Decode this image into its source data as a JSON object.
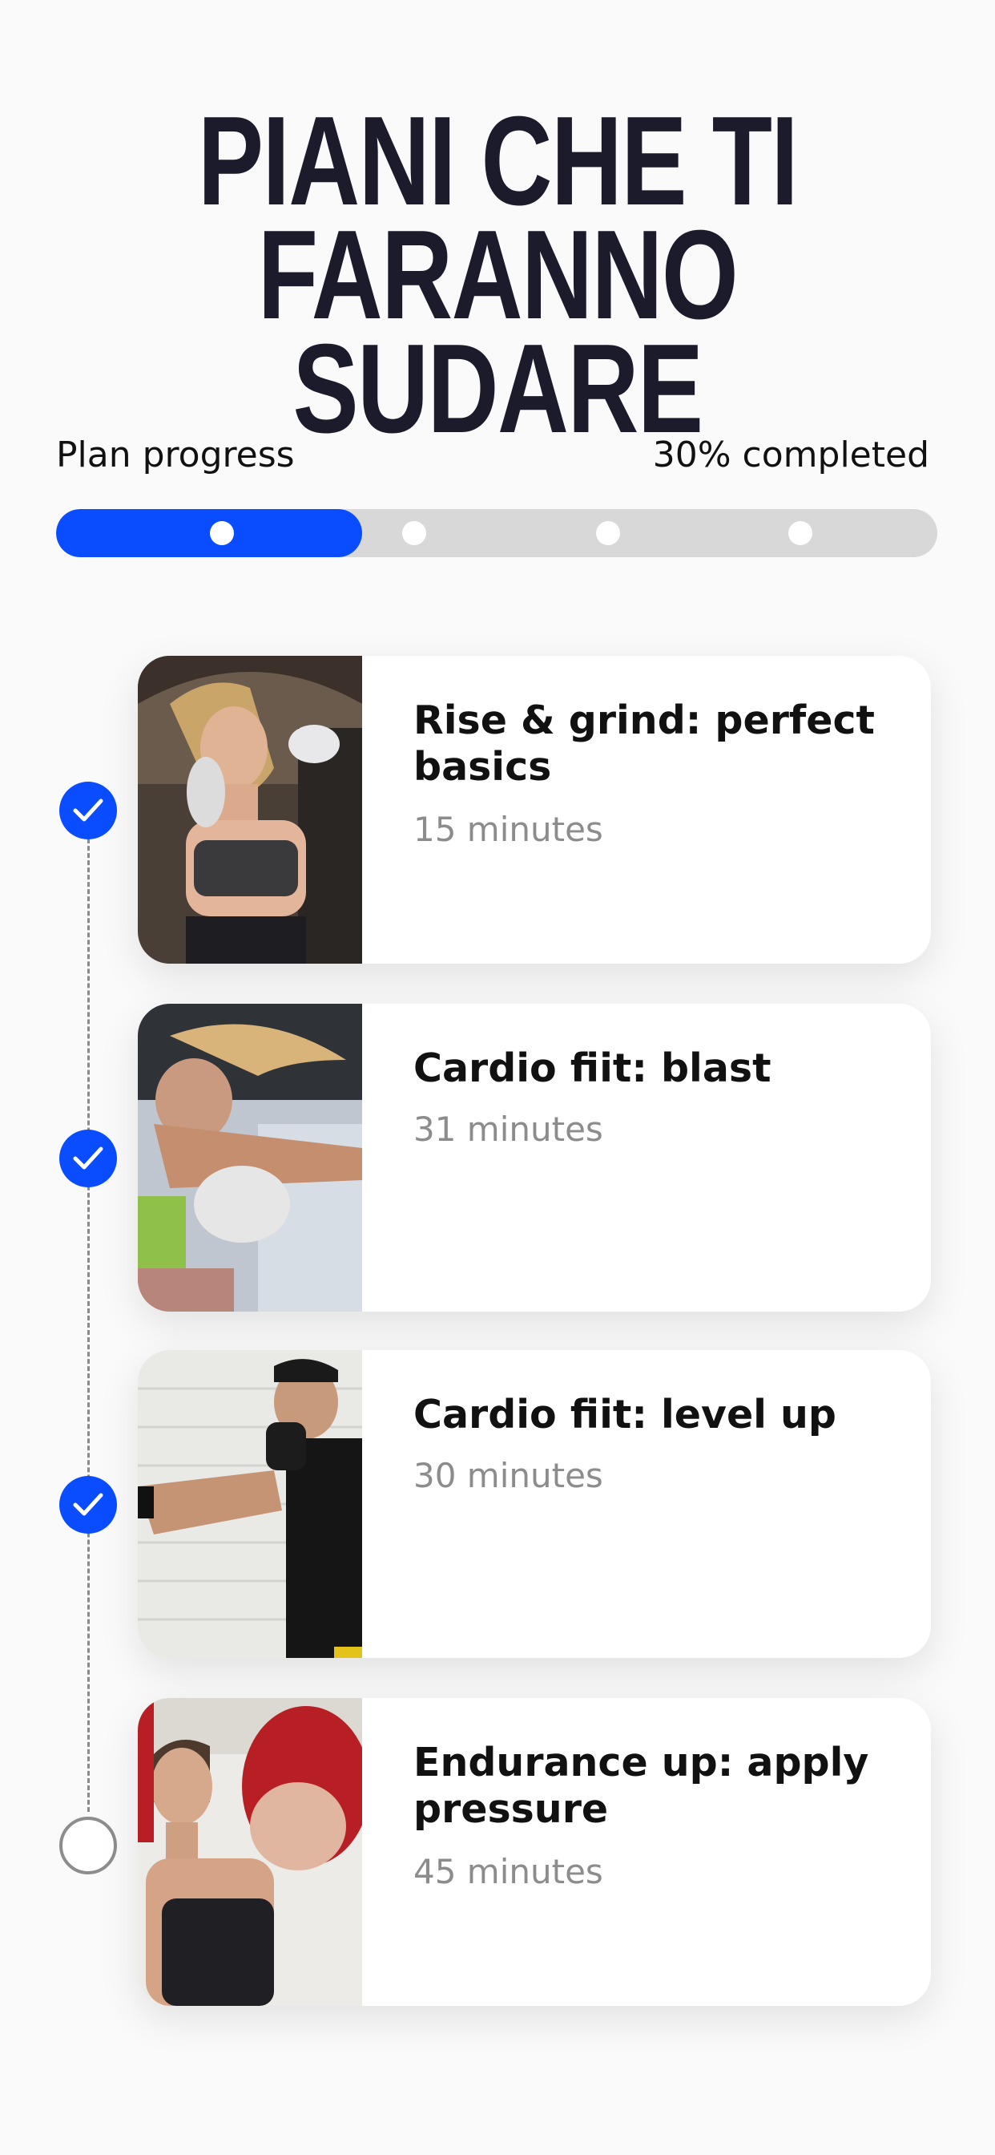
{
  "header": {
    "title_line1": "PIANI CHE TI",
    "title_line2": "FARANNO SUDARE"
  },
  "progress": {
    "label": "Plan progress",
    "completed_text": "30% completed",
    "value_percent": 30,
    "steps": 4,
    "accent_color": "#0a4cff"
  },
  "workouts": [
    {
      "title": "Rise & grind: perfect basics",
      "duration": "15 minutes",
      "done": true,
      "photo": "woman-boxing-stance-photo"
    },
    {
      "title": "Cardio fiit: blast",
      "duration": "31 minutes",
      "done": true,
      "photo": "woman-punching-photo"
    },
    {
      "title": "Cardio fiit: level up",
      "duration": "30 minutes",
      "done": true,
      "photo": "man-boxing-brick-wall-photo"
    },
    {
      "title": "Endurance up: apply pressure",
      "duration": "45 minutes",
      "done": false,
      "photo": "woman-red-gloves-photo"
    }
  ]
}
